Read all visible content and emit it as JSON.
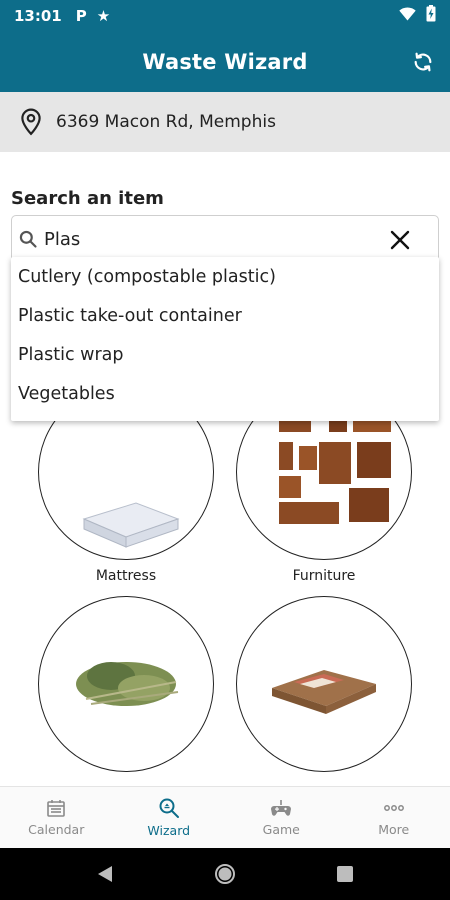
{
  "status_bar": {
    "time": "13:01",
    "left_icons": [
      "parking-icon",
      "star-icon"
    ],
    "right_icons": [
      "wifi-icon",
      "battery-charging-icon"
    ],
    "p_glyph": "P"
  },
  "app_bar": {
    "title": "Waste Wizard",
    "refresh_icon": "refresh-icon"
  },
  "location": {
    "icon": "location-pin-icon",
    "address": "6369 Macon Rd, Memphis"
  },
  "search": {
    "label": "Search an item",
    "value": "Plas",
    "icon": "search-icon",
    "clear_icon": "close-icon"
  },
  "suggestions": [
    "Cutlery (compostable plastic)",
    "Plastic take-out container",
    "Plastic wrap",
    "Vegetables"
  ],
  "categories": [
    {
      "label": "Mattress",
      "icon": "mattress-image"
    },
    {
      "label": "Furniture",
      "icon": "furniture-image"
    },
    {
      "label": "",
      "icon": "yard-waste-image"
    },
    {
      "label": "",
      "icon": "cardboard-image"
    }
  ],
  "bottom_nav": [
    {
      "label": "Calendar",
      "icon": "calendar-icon",
      "active": false
    },
    {
      "label": "Wizard",
      "icon": "wizard-search-icon",
      "active": true
    },
    {
      "label": "Game",
      "icon": "gamepad-icon",
      "active": false
    },
    {
      "label": "More",
      "icon": "more-dots-icon",
      "active": false
    }
  ],
  "colors": {
    "primary": "#0d6d8a",
    "location_bg": "#e6e6e6",
    "nav_inactive": "#8a8a8a"
  }
}
